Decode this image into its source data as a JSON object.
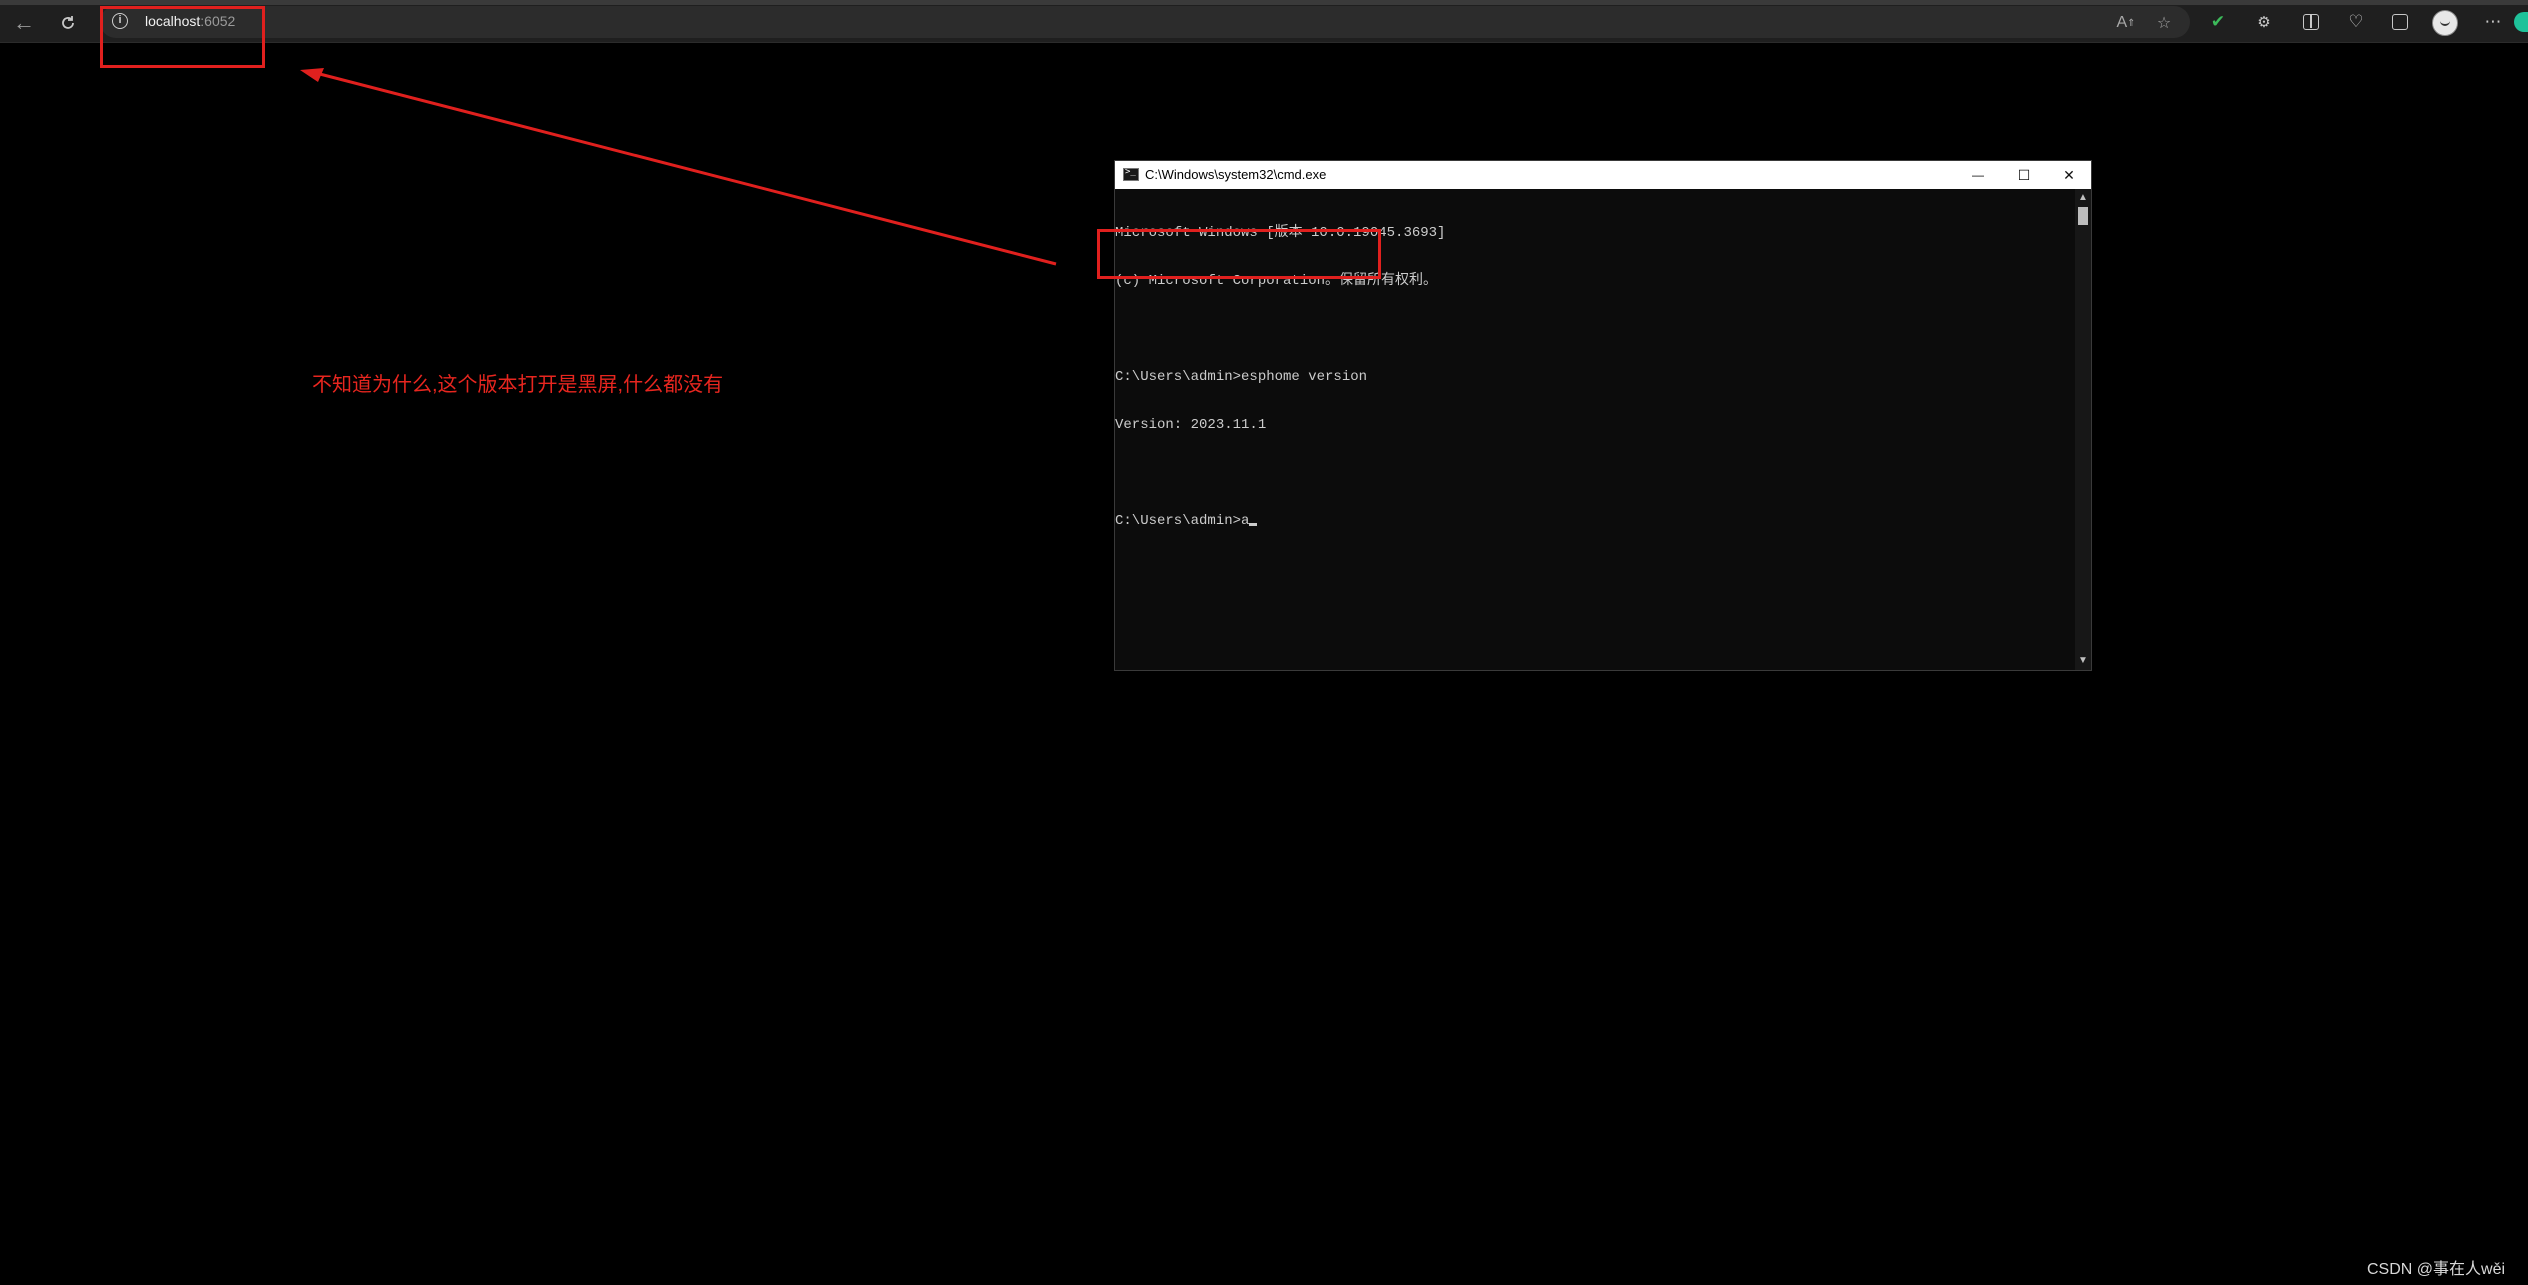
{
  "browser": {
    "url_host": "localhost",
    "url_port": ":6052",
    "icons": {
      "back": "back-arrow-icon",
      "refresh": "refresh-icon",
      "site_info": "info-icon",
      "read_aloud": "read-aloud-icon",
      "favorite": "star-icon",
      "extension_green": "extension-icon",
      "extensions": "puzzle-icon",
      "split_screen": "split-screen-icon",
      "health": "heart-icon",
      "collections": "collections-icon",
      "profile": "avatar",
      "more": "more-icon"
    }
  },
  "annotation": {
    "note": "不知道为什么,这个版本打开是黑屏,什么都没有",
    "color": "#e8261f"
  },
  "cmd_window": {
    "title": "C:\\Windows\\system32\\cmd.exe",
    "controls": {
      "minimize": "—",
      "maximize": "☐",
      "close": "✕"
    },
    "lines": [
      "Microsoft Windows [版本 10.0.19045.3693]",
      "(c) Microsoft Corporation。保留所有权利。",
      "C:\\Users\\admin>esphome version",
      "Version: 2023.11.1",
      "C:\\Users\\admin>a"
    ]
  },
  "watermark": "CSDN @事在人wěi"
}
